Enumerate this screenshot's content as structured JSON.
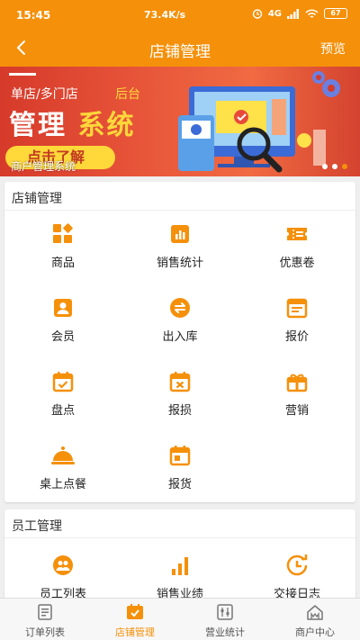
{
  "status_bar": {
    "time": "15:45",
    "network_speed": "73.4K/s",
    "signal_text": "4G",
    "battery": "67"
  },
  "nav": {
    "title": "店铺管理",
    "preview_label": "预览"
  },
  "banner": {
    "line1_white": "单店/多门店",
    "line1_yellow": "后台",
    "headline_white": "管理",
    "headline_yellow": "系统",
    "button_label": "点击了解",
    "caption": "商户管理系统",
    "page_count": 3,
    "active_index": 2
  },
  "store_section": {
    "title": "店铺管理",
    "items": [
      {
        "label": "商品",
        "icon": "grid-cube-icon"
      },
      {
        "label": "销售统计",
        "icon": "bar-chart-icon"
      },
      {
        "label": "优惠卷",
        "icon": "coupon-icon"
      },
      {
        "label": "会员",
        "icon": "member-card-icon"
      },
      {
        "label": "出入库",
        "icon": "transfer-arrows-icon"
      },
      {
        "label": "报价",
        "icon": "quote-document-icon"
      },
      {
        "label": "盘点",
        "icon": "calendar-check-icon"
      },
      {
        "label": "报损",
        "icon": "calendar-x-icon"
      },
      {
        "label": "营销",
        "icon": "gift-icon"
      },
      {
        "label": "桌上点餐",
        "icon": "cloche-icon"
      },
      {
        "label": "报货",
        "icon": "calendar-report-icon"
      }
    ]
  },
  "staff_section": {
    "title": "员工管理",
    "items": [
      {
        "label": "员工列表",
        "icon": "staff-group-icon"
      },
      {
        "label": "销售业绩",
        "icon": "signal-bars-icon"
      },
      {
        "label": "交接日志",
        "icon": "clock-refresh-icon"
      }
    ]
  },
  "tabs": [
    {
      "label": "订单列表",
      "icon": "order-list-icon",
      "active": false
    },
    {
      "label": "店铺管理",
      "icon": "store-check-icon",
      "active": true
    },
    {
      "label": "营业统计",
      "icon": "stats-sliders-icon",
      "active": false
    },
    {
      "label": "商户中心",
      "icon": "home-icon",
      "active": false
    }
  ],
  "colors": {
    "accent": "#f5900a",
    "banner_red": "#e04a32",
    "banner_yellow": "#ffd83a",
    "background": "#efefef"
  }
}
